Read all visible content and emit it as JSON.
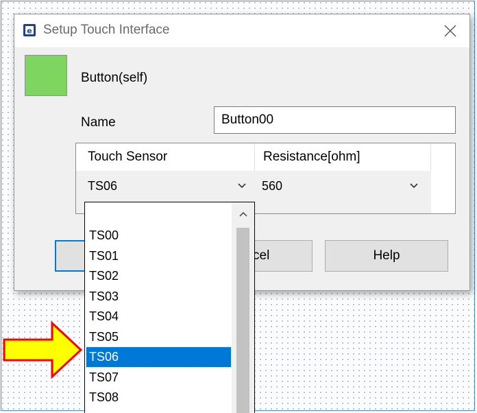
{
  "dialog": {
    "title": "Setup Touch Interface",
    "app_icon": "app-chip-icon",
    "close_icon": "close-icon"
  },
  "object": {
    "swatch_color": "#7ed560",
    "label": "Button(self)"
  },
  "name_field": {
    "label": "Name",
    "value": "Button00"
  },
  "grid": {
    "columns": [
      "Touch Sensor",
      "Resistance[ohm]"
    ],
    "row": {
      "touch_sensor": "TS06",
      "resistance": "560"
    }
  },
  "buttons": {
    "ok": "",
    "cancel": "cel",
    "help": "Help"
  },
  "dropdown": {
    "options": [
      "TS00",
      "TS01",
      "TS02",
      "TS03",
      "TS04",
      "TS05",
      "TS06",
      "TS07",
      "TS08"
    ],
    "selected": "TS06"
  },
  "annotation": {
    "arrow_fill": "#ffff00",
    "arrow_stroke": "#ff0000"
  },
  "colors": {
    "accent": "#0078d7",
    "frame": "#4a86c8"
  }
}
